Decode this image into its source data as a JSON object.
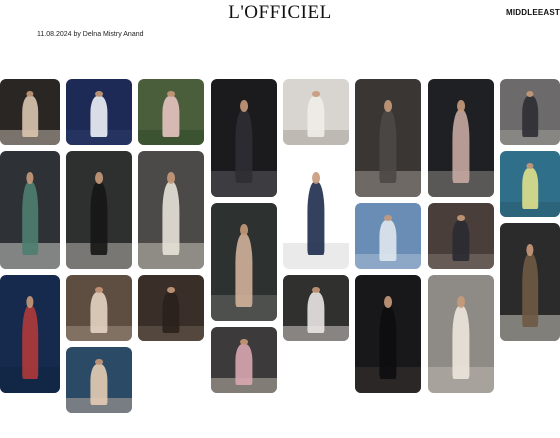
{
  "header": {
    "logo": "L'OFFICIEL",
    "edition": "MIDDLEEAST",
    "byline": "11.08.2024 by Delna Mistry Anand"
  },
  "gallery": {
    "tiles": [
      {
        "bg": "#2a2624",
        "fig": "#d9c7b0",
        "floor": "#b9b2a8"
      },
      {
        "bg": "#1c2a55",
        "fig": "#eef1f7",
        "floor": "#2c3a6a"
      },
      {
        "bg": "#4a5e3c",
        "fig": "#e6c3c0",
        "floor": "#324a2a"
      },
      {
        "bg": "#1b1b1e",
        "fig": "#2d2d33",
        "floor": "#5a5a5e"
      },
      {
        "bg": "#d8d4cf",
        "fig": "#f0ede8",
        "floor": "#a9a39b"
      },
      {
        "bg": "#3a3634",
        "fig": "#4c4846",
        "floor": "#9a9490"
      },
      {
        "bg": "#1f2024",
        "fig": "#c6a9a2",
        "floor": "#8b8680"
      },
      {
        "bg": "#6c6a6a",
        "fig": "#2f2f33",
        "floor": "#9f9c98"
      },
      {
        "bg": "#2e3236",
        "fig": "#4e7e70",
        "floor": "#c9c8c4"
      },
      {
        "bg": "#2e2f2f",
        "fig": "#161616",
        "floor": "#b8b3ac"
      },
      {
        "bg": "#4b4a48",
        "fig": "#e8e2d8",
        "floor": "#c8c2b8"
      },
      {
        "bg": "#ffffff",
        "fig": "#1d2c4e",
        "floor": "#d8d8d8"
      },
      {
        "bg": "#2f6f8a",
        "fig": "#dfe08a",
        "floor": "#2a5c70"
      },
      {
        "bg": "#2d3130",
        "fig": "#d1b19a",
        "floor": "#6a6a66"
      },
      {
        "bg": "#6a8db6",
        "fig": "#dfe7ee",
        "floor": "#a9bfd6"
      },
      {
        "bg": "#4a3e3a",
        "fig": "#2a2a33",
        "floor": "#7d746c"
      },
      {
        "bg": "#2b2b2b",
        "fig": "#6e5a44",
        "floor": "#c9c4bc"
      },
      {
        "bg": "#162a4e",
        "fig": "#b03a3a",
        "floor": "#10223f"
      },
      {
        "bg": "#5e4e42",
        "fig": "#e4d4c2",
        "floor": "#9e8e80"
      },
      {
        "bg": "#3a2f28",
        "fig": "#2a211c",
        "floor": "#6a5c50"
      },
      {
        "bg": "#30302f",
        "fig": "#e9e6e3",
        "floor": "#cfcac5"
      },
      {
        "bg": "#18181b",
        "fig": "#0d0d10",
        "floor": "#3a3430"
      },
      {
        "bg": "#8e8a86",
        "fig": "#ece5db",
        "floor": "#bdb7ae"
      },
      {
        "bg": "#2b4a66",
        "fig": "#e4ccb4",
        "floor": "#b8a89a"
      },
      {
        "bg": "#3c3a3a",
        "fig": "#d8a6b0",
        "floor": "#bbb3a8"
      }
    ]
  }
}
